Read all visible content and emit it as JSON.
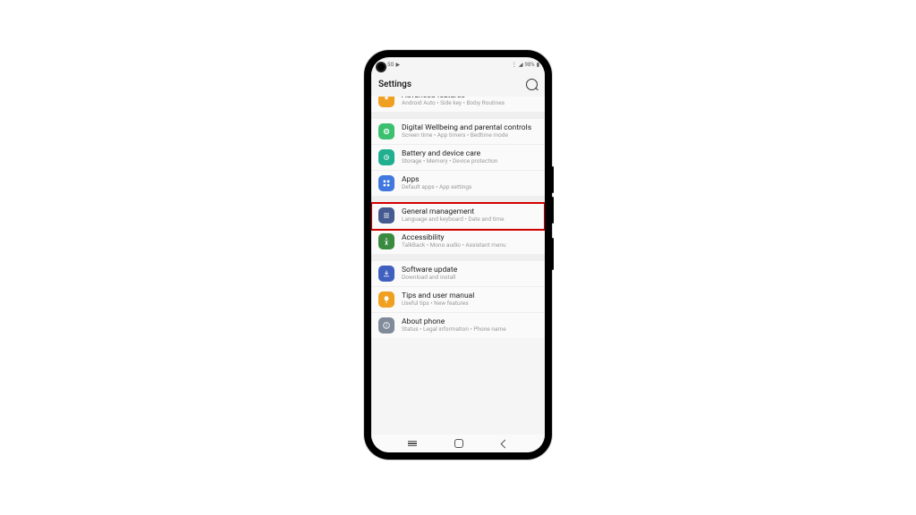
{
  "status": {
    "time_ind": "5G",
    "video_ind": "▶",
    "signal": "◢",
    "wifi": "⋮",
    "battery_pct": "98%",
    "battery": "▮"
  },
  "header": {
    "title": "Settings"
  },
  "groups": [
    {
      "rows": [
        {
          "icon": "advanced",
          "color": "#f0a020",
          "title": "Advanced features",
          "sub": "Android Auto  •  Side key  •  Bixby Routines",
          "cutoff": true
        }
      ]
    },
    {
      "rows": [
        {
          "icon": "wellbeing",
          "color": "#3cc070",
          "title": "Digital Wellbeing and parental controls",
          "sub": "Screen time  •  App timers  •  Bedtime mode"
        },
        {
          "icon": "battery",
          "color": "#20b090",
          "title": "Battery and device care",
          "sub": "Storage  •  Memory  •  Device protection"
        },
        {
          "icon": "apps",
          "color": "#4078e0",
          "title": "Apps",
          "sub": "Default apps  •  App settings"
        }
      ]
    },
    {
      "rows": [
        {
          "icon": "general",
          "color": "#455a90",
          "title": "General management",
          "sub": "Language and keyboard  •  Date and time",
          "highlighted": true
        },
        {
          "icon": "a11y",
          "color": "#3a8a40",
          "title": "Accessibility",
          "sub": "TalkBack  •  Mono audio  •  Assistant menu"
        }
      ]
    },
    {
      "rows": [
        {
          "icon": "update",
          "color": "#4060c0",
          "title": "Software update",
          "sub": "Download and install"
        },
        {
          "icon": "tips",
          "color": "#f0a020",
          "title": "Tips and user manual",
          "sub": "Useful tips  •  New features"
        },
        {
          "icon": "about",
          "color": "#808a99",
          "title": "About phone",
          "sub": "Status  •  Legal information  •  Phone name"
        }
      ]
    }
  ]
}
